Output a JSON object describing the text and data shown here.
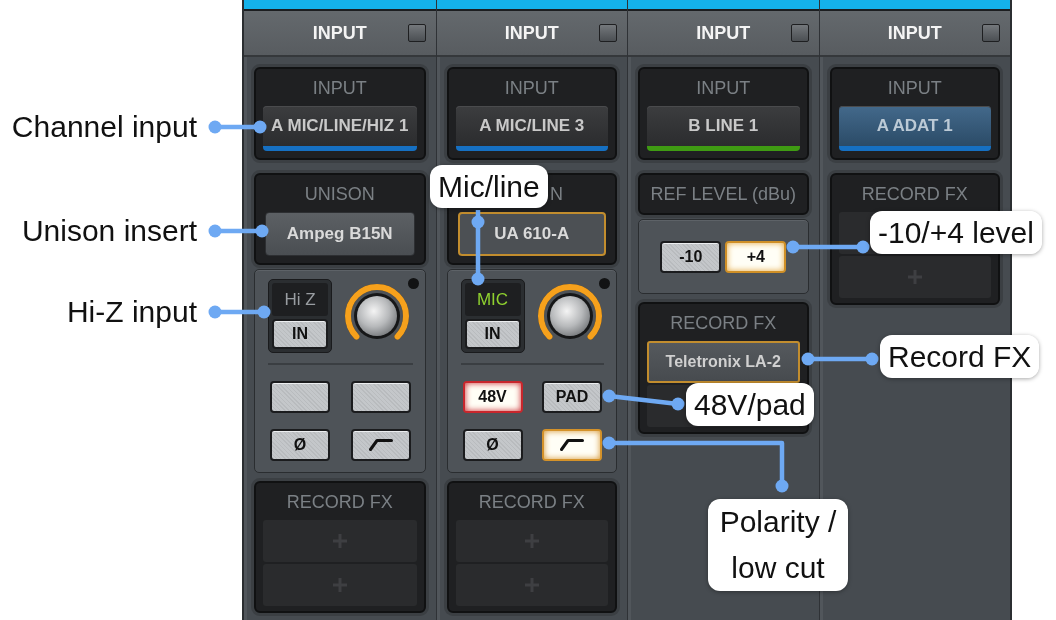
{
  "channels": [
    {
      "header": {
        "title": "INPUT",
        "toggle_on": false
      },
      "sections": [
        {
          "kind": "input",
          "label": "INPUT",
          "value": "A MIC/LINE/HIZ 1",
          "color": "#1670c2",
          "selected": false
        },
        {
          "kind": "unison",
          "label": "UNISON",
          "value": "Ampeg B15N",
          "selected": false
        },
        {
          "kind": "preamp",
          "source": {
            "text": "Hi Z",
            "active": false
          },
          "in_button": {
            "text": "IN",
            "on": false
          },
          "gain": {
            "level": 1
          },
          "peak_on": false,
          "buttons": [
            {
              "kind": "blank",
              "on": false
            },
            {
              "kind": "blank",
              "on": false
            },
            {
              "kind": "text",
              "text": "Ø",
              "on": false
            },
            {
              "kind": "slope",
              "on": false
            }
          ]
        },
        {
          "kind": "record_fx",
          "label": "RECORD FX",
          "slots": [
            {
              "kind": "add",
              "selected": false
            },
            {
              "kind": "add",
              "selected": false
            }
          ]
        }
      ]
    },
    {
      "header": {
        "title": "INPUT",
        "toggle_on": false
      },
      "sections": [
        {
          "kind": "input",
          "label": "INPUT",
          "value": "A MIC/LINE 3",
          "color": "#1670c2",
          "selected": false
        },
        {
          "kind": "unison",
          "label": "N",
          "label_clipped": true,
          "value": "UA 610-A",
          "selected": true
        },
        {
          "kind": "preamp",
          "source": {
            "text": "MIC",
            "active": true
          },
          "in_button": {
            "text": "IN",
            "on": false
          },
          "gain": {
            "level": 1
          },
          "peak_on": false,
          "buttons": [
            {
              "kind": "text",
              "text": "48V",
              "on": true,
              "color": "#c8262c"
            },
            {
              "kind": "text",
              "text": "PAD",
              "on": false
            },
            {
              "kind": "text",
              "text": "Ø",
              "on": false
            },
            {
              "kind": "slope",
              "on": true,
              "color": "#d4922a"
            }
          ]
        },
        {
          "kind": "record_fx",
          "label": "RECORD FX",
          "slots": [
            {
              "kind": "add",
              "selected": false
            },
            {
              "kind": "add",
              "selected": false
            }
          ]
        }
      ]
    },
    {
      "header": {
        "title": "INPUT",
        "toggle_on": false
      },
      "sections": [
        {
          "kind": "input",
          "label": "INPUT",
          "value": "B LINE 1",
          "color": "#3f9b13",
          "selected": false
        },
        {
          "kind": "ref_level",
          "label": "REF LEVEL (dBu)",
          "options": [
            {
              "text": "-10",
              "selected": false
            },
            {
              "text": "+4",
              "selected": true
            }
          ]
        },
        {
          "kind": "record_fx",
          "label": "RECORD FX",
          "slots": [
            {
              "kind": "plugin",
              "name": "Teletronix LA-2",
              "selected": true
            },
            {
              "kind": "empty",
              "selected": false
            }
          ]
        }
      ]
    },
    {
      "header": {
        "title": "INPUT",
        "toggle_on": false
      },
      "sections": [
        {
          "kind": "input",
          "label": "INPUT",
          "value": "A ADAT 1",
          "color": "#1670c2",
          "selected": true
        },
        {
          "kind": "record_fx",
          "label": "RECORD FX",
          "slots": [
            {
              "kind": "empty",
              "selected": false
            },
            {
              "kind": "add",
              "selected": false
            }
          ]
        }
      ]
    }
  ],
  "annotations": [
    {
      "text": "Channel input"
    },
    {
      "text": "Unison insert"
    },
    {
      "text": "Hi-Z input"
    },
    {
      "text": "Mic/line"
    },
    {
      "text": "-10/+4 level"
    },
    {
      "text": "Record FX"
    },
    {
      "text": "48V/pad"
    },
    {
      "text": "Polarity / low cut"
    }
  ]
}
